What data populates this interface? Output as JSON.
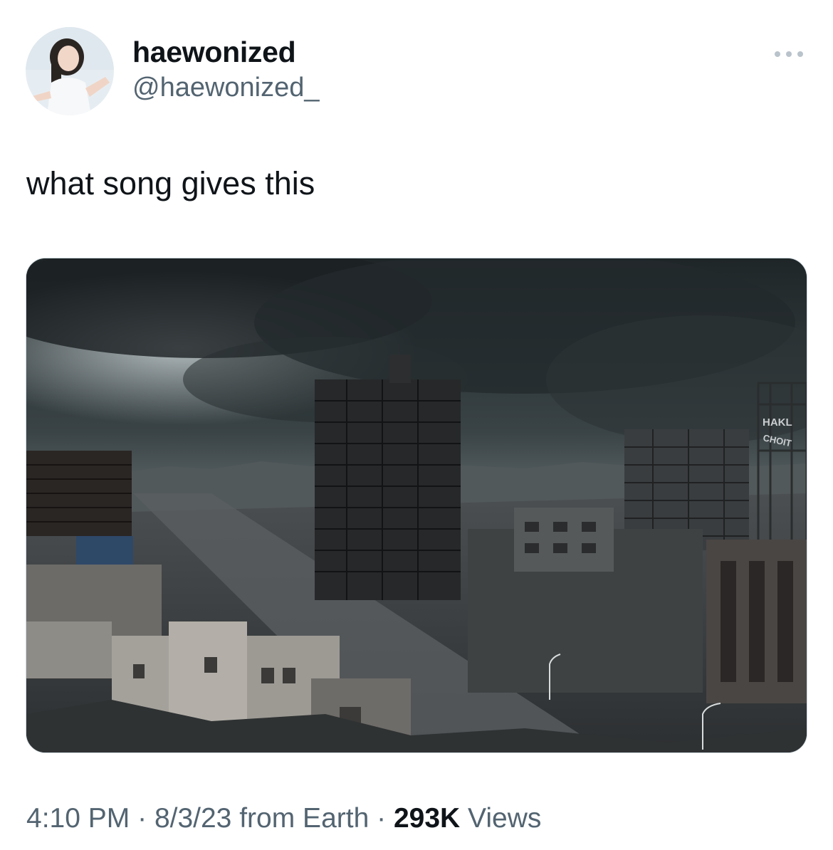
{
  "author": {
    "display_name": "haewonized",
    "handle": "@haewonized_",
    "avatar_icon": "profile-photo"
  },
  "more_icon": "more-horizontal-icon",
  "tweet": {
    "text": "what song gives this"
  },
  "media": {
    "sign_line_1": "HAKL",
    "sign_line_2": "CHOIT"
  },
  "meta": {
    "time": "4:10 PM",
    "date": "8/3/23",
    "source": "from Earth",
    "views_count": "293K",
    "views_label": "Views",
    "separator": "·"
  },
  "colors": {
    "text_primary": "#0f1419",
    "text_secondary": "#536471"
  }
}
